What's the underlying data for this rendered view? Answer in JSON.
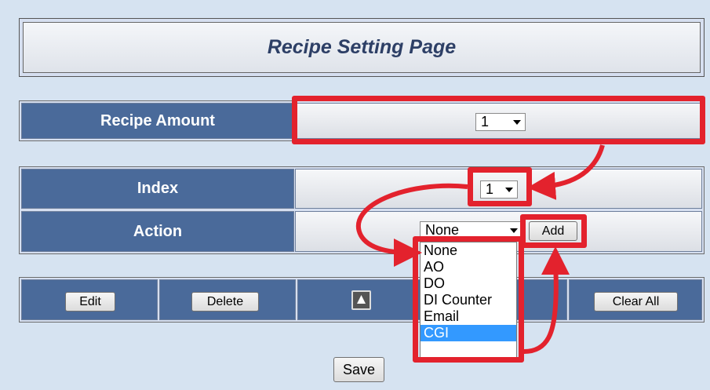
{
  "page": {
    "title": "Recipe Setting Page"
  },
  "recipe_amount": {
    "label": "Recipe Amount",
    "selected": "1"
  },
  "index": {
    "label": "Index",
    "selected": "1"
  },
  "action": {
    "label": "Action",
    "selected": "None",
    "add_label": "Add",
    "options": [
      "None",
      "AO",
      "DO",
      "DI Counter",
      "Email",
      "CGI"
    ],
    "highlighted_option": "CGI"
  },
  "toolbar": {
    "edit_label": "Edit",
    "delete_label": "Delete",
    "up_icon": "triangle-up-icon",
    "clear_all_label": "Clear All"
  },
  "save_label": "Save",
  "annotation_color": "#e3222d"
}
